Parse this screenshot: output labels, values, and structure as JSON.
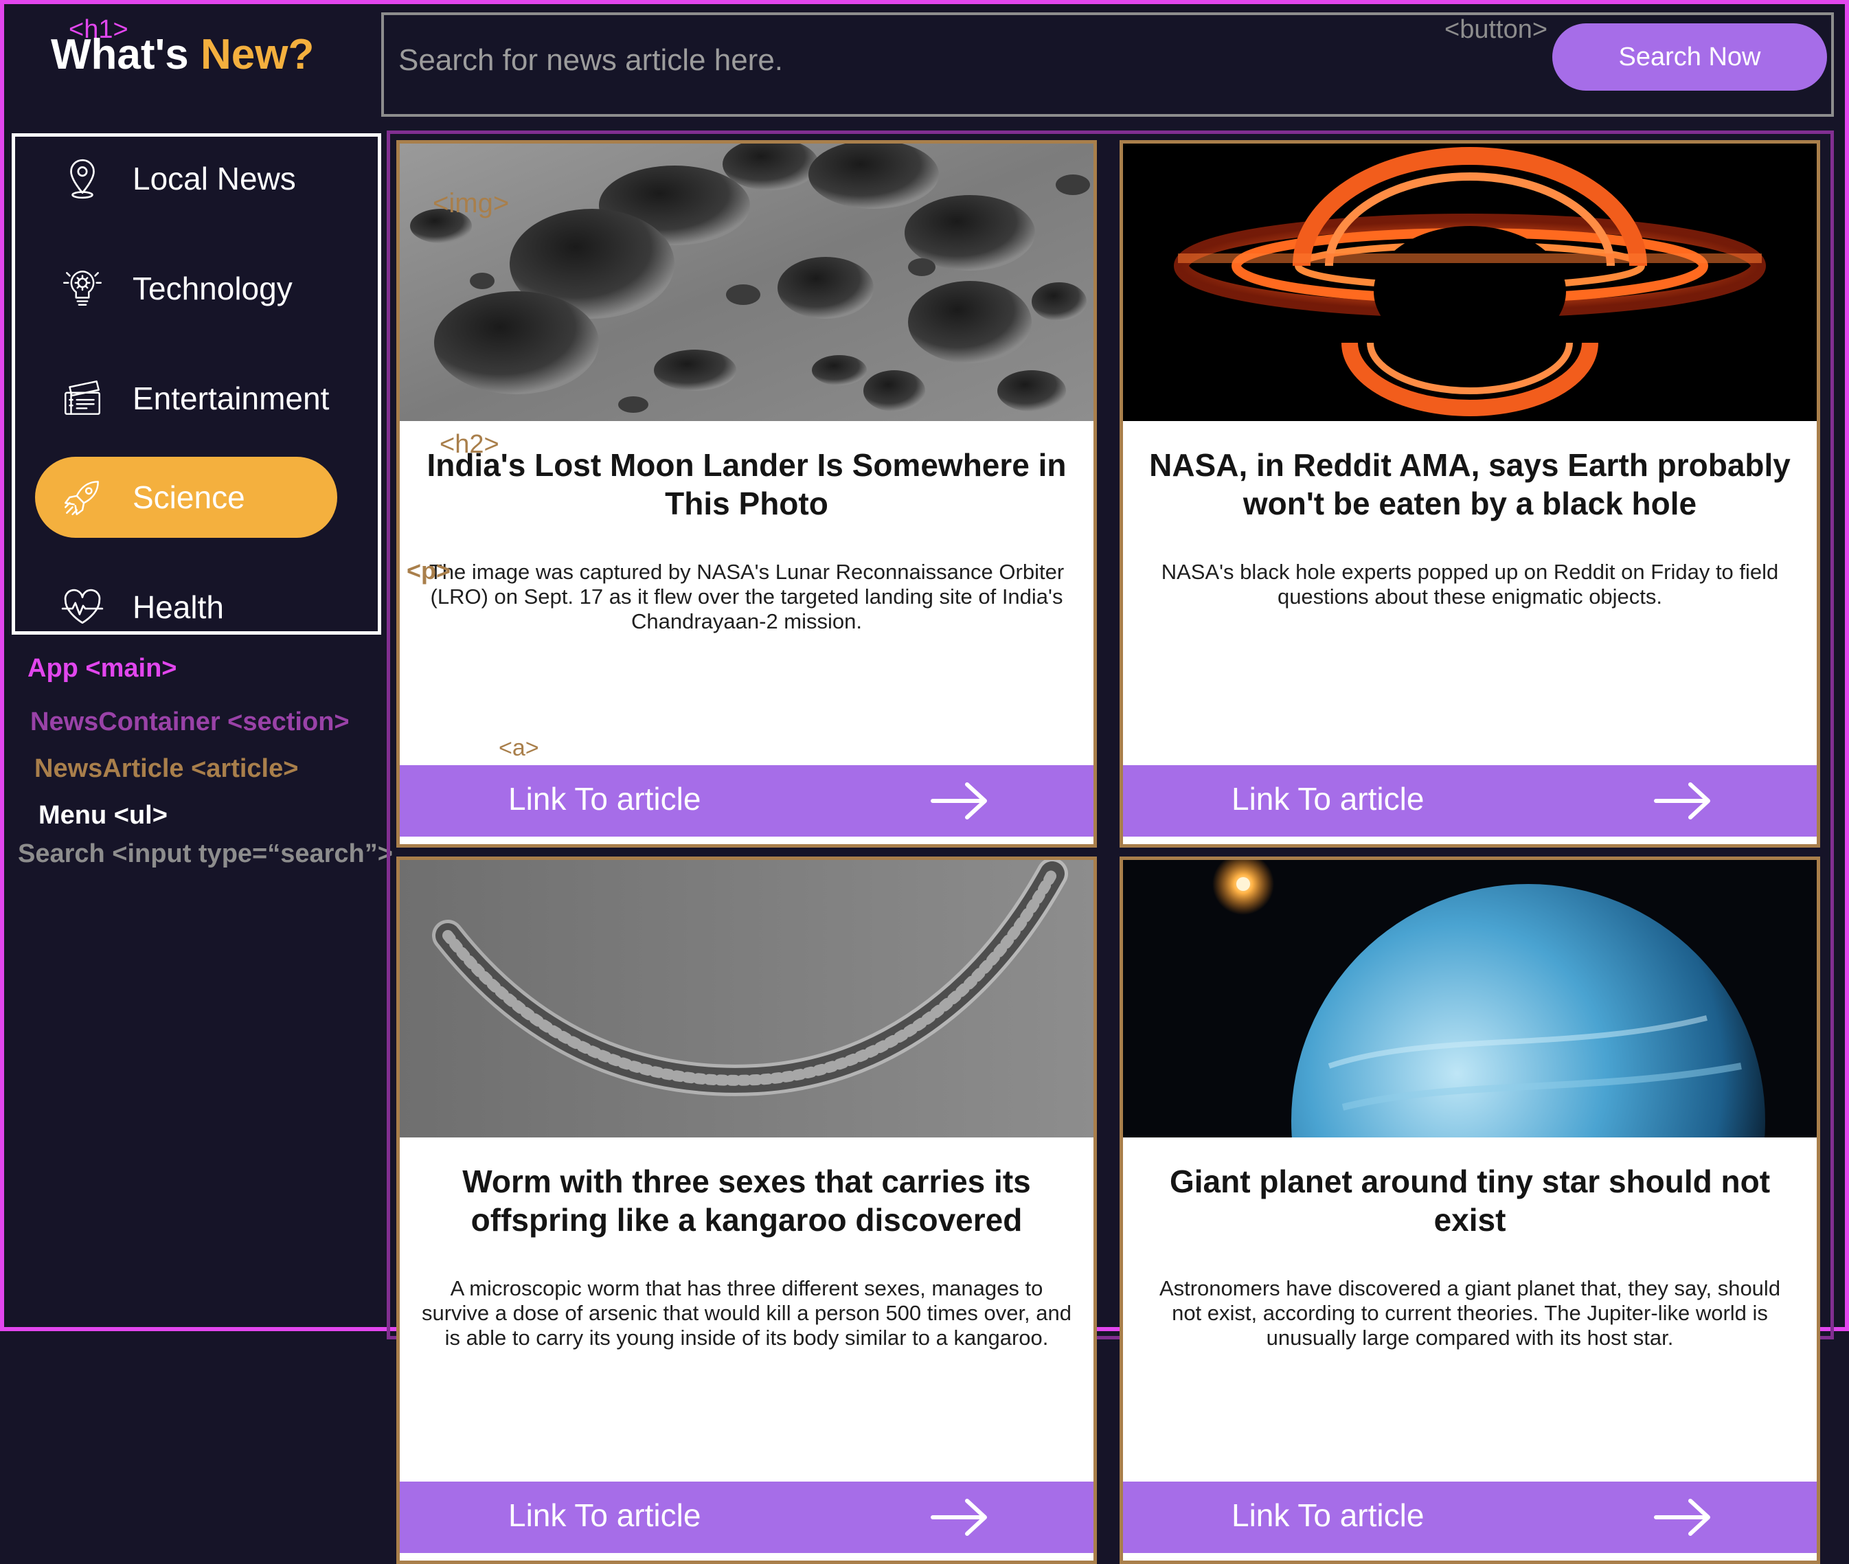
{
  "header": {
    "h1_tag": "<h1>",
    "title_main": "What's",
    "title_accent": "New?",
    "search_placeholder": "Search for news article here.",
    "button_tag": "<button>",
    "search_button_label": "Search Now"
  },
  "menu": {
    "items": [
      {
        "label": "Local News",
        "icon": "location-pin-icon"
      },
      {
        "label": "Technology",
        "icon": "gear-bulb-icon"
      },
      {
        "label": "Entertainment",
        "icon": "ticket-icon"
      },
      {
        "label": "Science",
        "icon": "rocket-icon",
        "active": true
      },
      {
        "label": "Health",
        "icon": "heart-pulse-icon"
      }
    ]
  },
  "legend": {
    "app": "App <main>",
    "container": "NewsContainer <section>",
    "article": "NewsArticle <article>",
    "menu": "Menu <ul>",
    "search": "Search <input type=“search”>"
  },
  "tags": {
    "img": "<img>",
    "h2": "<h2>",
    "p": "<p>",
    "a": "<a>"
  },
  "articles": [
    {
      "title": "India's Lost Moon Lander Is Somewhere in This Photo",
      "summary": "The image was captured by NASA's Lunar Reconnaissance Orbiter (LRO) on Sept. 17 as it flew over the targeted landing site of India's Chandrayaan-2 mission.",
      "link_label": "Link To article",
      "image": "moon-surface-image"
    },
    {
      "title": "NASA, in Reddit AMA, says Earth probably won't be eaten by a black hole",
      "summary": "NASA's black hole experts popped up on Reddit on Friday to field questions about these enigmatic objects.",
      "link_label": "Link To article",
      "image": "black-hole-image"
    },
    {
      "title": "Worm with three sexes that carries its offspring like a kangaroo discovered",
      "summary": "A microscopic worm that has three different sexes, manages to survive a dose of arsenic that would kill a person 500 times over, and is able to carry its young inside of its body similar to a kangaroo.",
      "link_label": "Link To article",
      "image": "worm-microscope-image"
    },
    {
      "title": "Giant planet around tiny star should not exist",
      "summary": "Astronomers have discovered a giant planet that, they say, should not exist, according to current theories. The Jupiter-like world is unusually large compared with its host star.",
      "link_label": "Link To article",
      "image": "blue-planet-image"
    }
  ],
  "colors": {
    "background": "#161428",
    "accent_orange": "#f4b03e",
    "accent_purple": "#a66de8",
    "outline_magenta": "#e246ee",
    "outline_section": "#822f91",
    "outline_article": "#a97f4b"
  }
}
